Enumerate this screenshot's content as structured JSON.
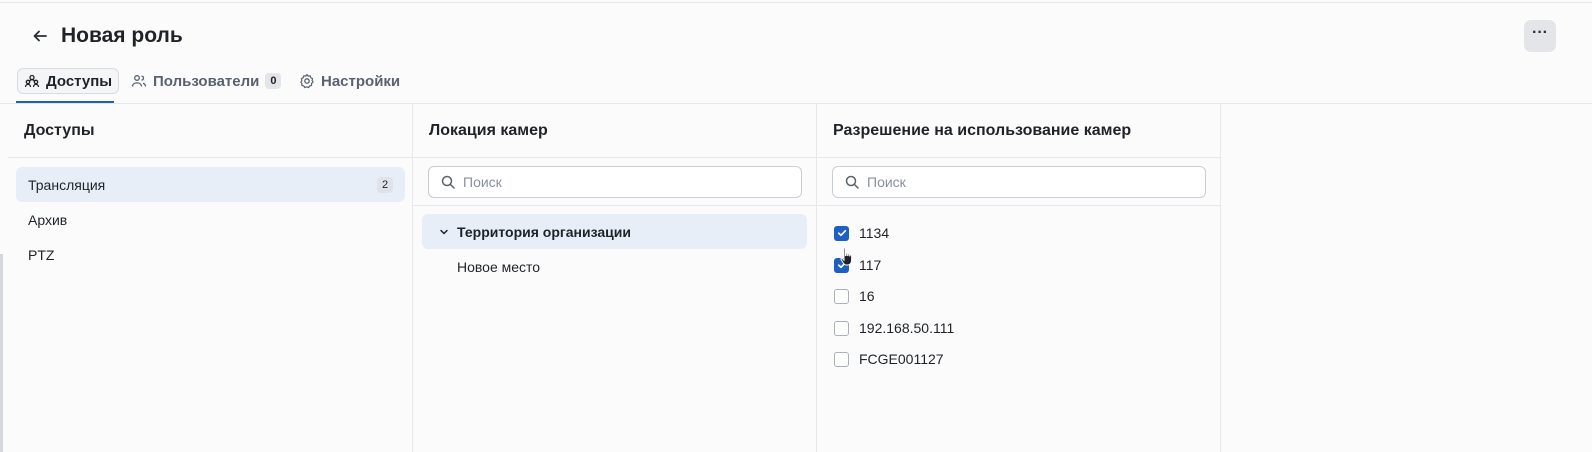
{
  "header": {
    "title": "Новая роль",
    "more_label": "···"
  },
  "tabs": [
    {
      "label": "Доступы",
      "icon": "users-group-icon",
      "active": true
    },
    {
      "label": "Пользователи",
      "icon": "users-icon",
      "count": "0"
    },
    {
      "label": "Настройки",
      "icon": "gear-icon"
    }
  ],
  "permissions_panel": {
    "title": "Доступы",
    "items": [
      {
        "label": "Трансляция",
        "count": "2",
        "active": true
      },
      {
        "label": "Архив"
      },
      {
        "label": "PTZ"
      }
    ]
  },
  "locations_panel": {
    "title": "Локация камер",
    "search_placeholder": "Поиск",
    "tree": [
      {
        "label": "Территория организации",
        "expanded": true,
        "active": true
      },
      {
        "label": "Новое место"
      }
    ]
  },
  "cameras_panel": {
    "title": "Разрешение на использование камер",
    "search_placeholder": "Поиск",
    "cameras": [
      {
        "label": "1134",
        "checked": true
      },
      {
        "label": "117",
        "checked": true
      },
      {
        "label": "16",
        "checked": false
      },
      {
        "label": "192.168.50.111",
        "checked": false
      },
      {
        "label": "FCGE001127",
        "checked": false
      }
    ]
  },
  "colors": {
    "accent": "#1e5fbf",
    "active_bg": "#e8eef7"
  }
}
